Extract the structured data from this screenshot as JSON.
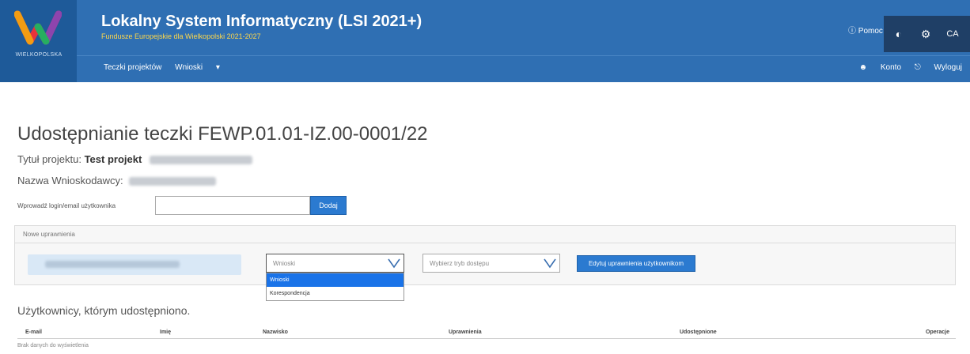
{
  "header": {
    "logo_caption": "WIELKOPOLSKA",
    "title": "Lokalny System Informatyczny (LSI 2021+)",
    "subtitle": "Fundusze Europejskie dla Wielkopolski 2021-2027",
    "help_label": "Pomoc",
    "font_label": "CA",
    "nav_items": [
      "Teczki projektów",
      "Wnioski"
    ],
    "nav_right": [
      "Konto",
      "Wyloguj"
    ],
    "colors": {
      "primary": "#2f6fb3",
      "accent": "#ffd84a",
      "dark": "#1f3f66"
    }
  },
  "main": {
    "page_title": "Udostępnianie teczki FEWP.01.01-IZ.00-0001/22",
    "project_title_label": "Tytuł projektu:",
    "project_title_value": "Test projekt",
    "applicant_label": "Nazwa Wnioskodawcy:",
    "login_label": "Wprowadź login/email użytkownika",
    "login_value": "",
    "add_button": "Dodaj",
    "panel_header": "Nowe uprawnienia",
    "access_select": {
      "selected": "Wnioski",
      "options": [
        "Wnioski",
        "Korespondencja"
      ]
    },
    "mode_select": {
      "placeholder": "Wybierz tryb dostępu"
    },
    "edit_button": "Edytuj uprawnienia użytkownikom",
    "shared_users_title": "Użytkownicy, którym udostępniono.",
    "table_columns": [
      "E-mail",
      "Imię",
      "Nazwisko",
      "Uprawnienia",
      "Udostępnione",
      "Operacje"
    ],
    "empty_table": "Brak danych do wyświetlenia"
  }
}
